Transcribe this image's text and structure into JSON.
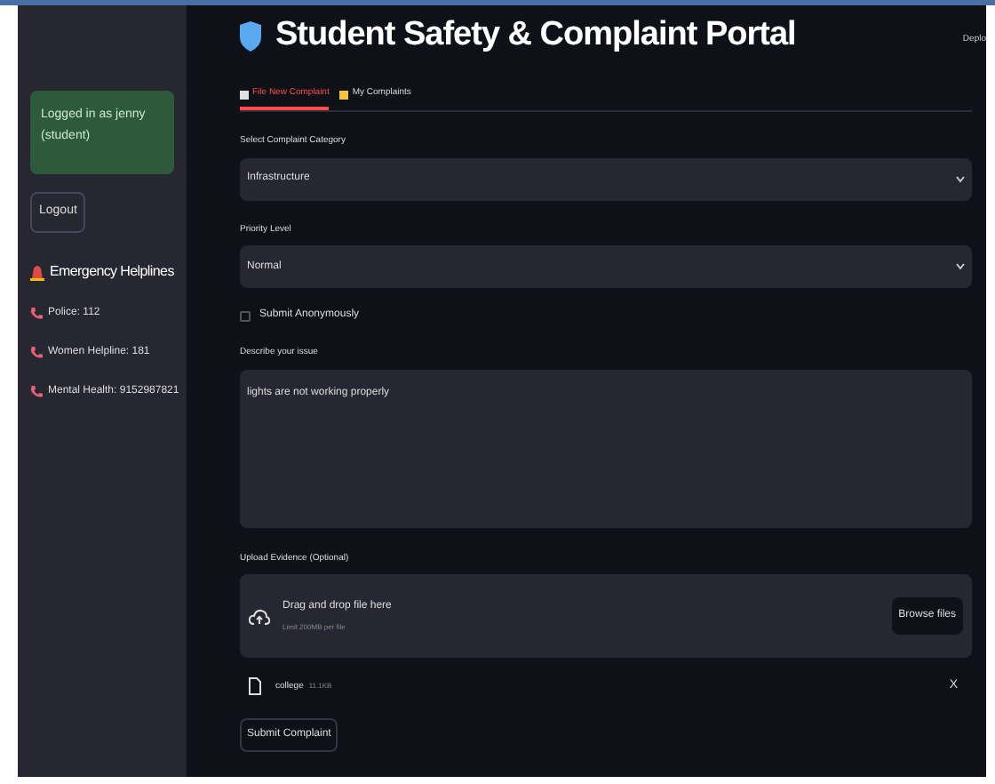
{
  "sidebar": {
    "login_message": "Logged in as jenny (student)",
    "logout_button": "Logout",
    "helplines_title": "Emergency Helplines",
    "helplines": [
      {
        "label": "Police: 112"
      },
      {
        "label": "Women Helpline: 181"
      },
      {
        "label": "Mental Health: 9152987821"
      }
    ]
  },
  "header": {
    "title": "Student Safety & Complaint Portal",
    "deploy": "Deplo"
  },
  "tabs": [
    {
      "label": "File New Complaint",
      "selected": true
    },
    {
      "label": "My Complaints",
      "selected": false
    }
  ],
  "form": {
    "category": {
      "label": "Select Complaint Category",
      "value": "Infrastructure"
    },
    "priority": {
      "label": "Priority Level",
      "value": "Normal"
    },
    "anonymous": {
      "label": "Submit Anonymously",
      "checked": false
    },
    "issue": {
      "label": "Describe your issue",
      "value": "lights are not working properly"
    },
    "upload": {
      "label": "Upload Evidence (Optional)",
      "drop_text": "Drag and drop file here",
      "limit": "Limit 200MB per file",
      "browse_button": "Browse files",
      "file": {
        "name": "college",
        "size": "11.1KB",
        "remove": "X"
      }
    },
    "submit_button": "Submit Complaint"
  }
}
